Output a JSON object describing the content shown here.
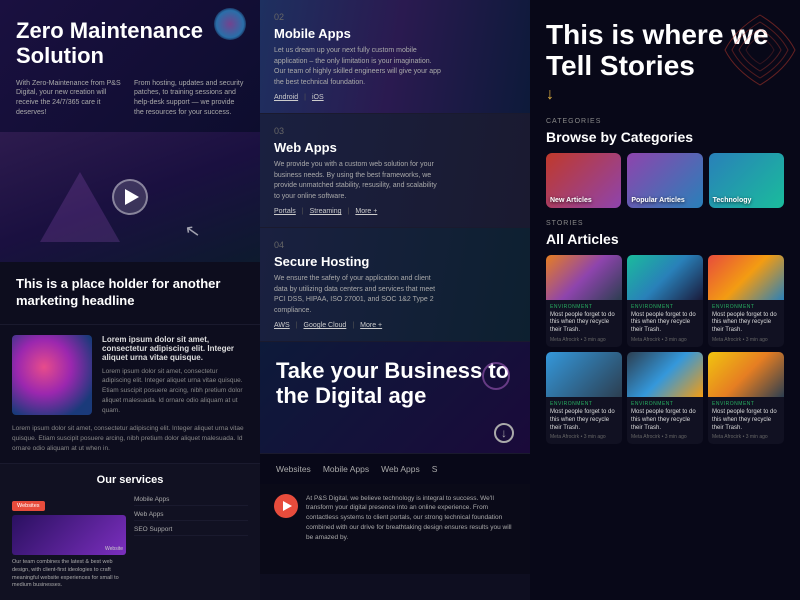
{
  "left": {
    "hero": {
      "title": "Zero Maintenance Solution",
      "left_text": "With Zero-Maintenance from P&S Digital, your new creation will receive the 24/7/365 care it deserves!",
      "right_text": "From hosting, updates and security patches, to training sessions and help-desk support — we provide the resources for your success."
    },
    "placeholder": {
      "heading": "This is a place holder for another marketing headline"
    },
    "lorem": {
      "heading": "Lorem ipsum dolor sit amet, consectetur adipiscing elit. Integer aliquet urna vitae quisque.",
      "body": "Lorem ipsum dolor sit amet, consectetur adipiscing elit. Integer aliquet urna vitae quisque. Etiam suscipit posuere arcing, nibh pretium dolor aliquet malesuada. Id ornare odio aliquam at ut quam.",
      "below": "Lorem ipsum dolor sit amet, consectetur adipiscing elit. Integer aliquet urna vitae quisque. Etiam suscipit posuere arcing, nibh pretium dolor aliquet malesuada. Id ornare odio aliquam at ut when in."
    },
    "services": {
      "title": "Our services",
      "chip": "Websites",
      "desc": "Our team combines the latest & best web design, with client-first ideologies to craft meaningful website experiences for small to medium businesses.",
      "list": [
        "Mobile Apps",
        "Web Apps",
        "SEO Support"
      ]
    }
  },
  "mid": {
    "cards": [
      {
        "num": "02",
        "title": "Mobile Apps",
        "desc": "Let us dream up your next fully custom mobile application – the only limitation is your imagination. Our team of highly skilled engineers will give your app the best technical foundation.",
        "tags": [
          "Android",
          "iOS"
        ]
      },
      {
        "num": "03",
        "title": "Web Apps",
        "desc": "We provide you with a custom web solution for your business needs. By using the best frameworks, we provide unmatched stability, resusility, and scalability to your online software.",
        "tags": [
          "Portals",
          "Streaming",
          "More +"
        ]
      },
      {
        "num": "04",
        "title": "Secure Hosting",
        "desc": "We ensure the safety of your application and client data by utilizing data centers and services that meet PCI DSS, HIPAA, ISO 27001, and SOC 1&2 Type 2 compliance.",
        "tags": [
          "AWS",
          "Google Cloud",
          "More +"
        ]
      }
    ],
    "cta": {
      "heading": "Take your Business to the Digital age"
    },
    "nav_tabs": [
      "Websites",
      "Mobile Apps",
      "Web Apps",
      "S"
    ],
    "bottom_desc": "At P&S Digital, we believe technology is integral to success. We'll transform your digital presence into an online experience. From contactless systems to client portals, our strong technical foundation combined with our drive for breathtaking design ensures results you will be amazed by."
  },
  "right": {
    "stories_title": "This is where we Tell Stories",
    "cat_label": "Categories",
    "cat_heading": "Browse by Categories",
    "categories": [
      {
        "label": "New Articles"
      },
      {
        "label": "Popular Articles"
      },
      {
        "label": "Technology"
      }
    ],
    "stories_label": "Stories",
    "all_articles_heading": "All Articles",
    "articles": [
      {
        "env": "Environment",
        "title": "Most people forget to do this when they recycle their Trash.",
        "author": "Meta Afrocirk • 3 minutes ago",
        "img_class": "article-img-sunset"
      },
      {
        "env": "Environment",
        "title": "Most people forget to do this when they recycle their Trash.",
        "author": "Meta Afrocirk • 3 minutes ago",
        "img_class": "article-img-earth"
      },
      {
        "env": "Environment",
        "title": "Most people forget to do this when they recycle their Trash.",
        "author": "Meta Afrocirk • 3 minutes ago",
        "img_class": "article-img-abstract"
      },
      {
        "env": "Environment",
        "title": "Most people forget to do this when they recycle their Trash.",
        "author": "Meta Afrocirk • 3 minutes ago",
        "img_class": "article-img-people"
      },
      {
        "env": "Environment",
        "title": "Most people forget to do this when they recycle their Trash.",
        "author": "Meta Afrocirk • 3 minutes ago",
        "img_class": "article-img-city"
      },
      {
        "env": "Environment",
        "title": "Most people forget to do this when they recycle their Trash.",
        "author": "Meta Afrocirk • 3 minutes ago",
        "img_class": "article-img-nature"
      }
    ]
  }
}
